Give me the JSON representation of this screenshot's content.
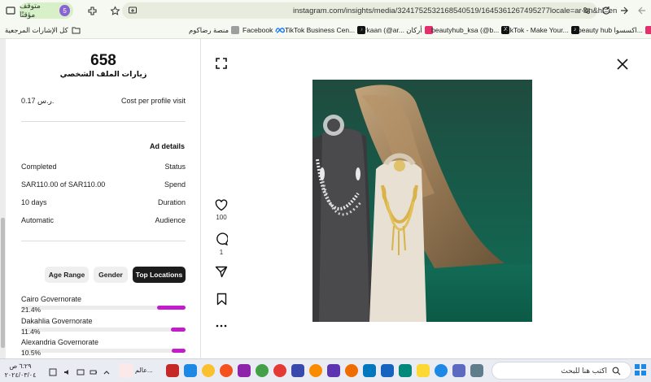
{
  "browser": {
    "url": "instagram.com/insights/media/3241752532168540519/1645361267495277locale=ar-en&hl=en",
    "profile_status": "متوقف مؤقتًا",
    "profile_initial": "5",
    "icons": [
      "back-icon",
      "forward-icon",
      "reload-icon",
      "site-settings-icon",
      "star-icon",
      "extensions-icon"
    ]
  },
  "bookmarks": {
    "all_bookmarks": "كل الإشارات المرجعية",
    "items": [
      {
        "label": "منصة رضاكوم",
        "color": "#9e9e9e"
      },
      {
        "label": "Facebook",
        "color": "#1877f2"
      },
      {
        "label": "TikTok Business Cen...",
        "color": "#111111"
      },
      {
        "label": "Arkaan (@ar... أركان",
        "color": "#111111"
      },
      {
        "label": "beautyhub_ksa (@b...",
        "color": "#e1306c"
      },
      {
        "label": "TikTok - Make Your...",
        "color": "#111111"
      },
      {
        "label": "beauty hub اكسسوا...",
        "color": "#e1306c"
      }
    ]
  },
  "insights": {
    "profile_visits_value": "658",
    "profile_visits_label": "زيارات الملف الشخصي",
    "cost_label": "Cost per profile visit",
    "cost_value": "0.17 ر.س.",
    "ad_details_title": "Ad details",
    "details": [
      {
        "label": "Status",
        "value": "Completed"
      },
      {
        "label": "Spend",
        "value": "SAR110.00 of SAR110.00"
      },
      {
        "label": "Duration",
        "value": "10 days"
      },
      {
        "label": "Audience",
        "value": "Automatic"
      }
    ],
    "tabs": [
      {
        "label": "Age Range",
        "active": false
      },
      {
        "label": "Gender",
        "active": false
      },
      {
        "label": "Top Locations",
        "active": true
      }
    ],
    "locations": [
      {
        "name": "Cairo Governorate",
        "percent": "21.4%",
        "share": 21.4
      },
      {
        "name": "Dakahlia Governorate",
        "percent": "11.4%",
        "share": 11.4
      },
      {
        "name": "Alexandria Governorate",
        "percent": "10.5%",
        "share": 10.5
      }
    ],
    "bar_color": "#c41ccc"
  },
  "post": {
    "likes": "100",
    "comments": "1",
    "icons": [
      "expand-icon",
      "close-icon",
      "heart-icon",
      "comment-icon",
      "share-icon",
      "save-icon",
      "more-icon"
    ]
  },
  "taskbar": {
    "search_placeholder": "اكتب هنا للبحث",
    "time": "٦:٢٩ ص",
    "date": "٢٠٢٤/٠٣/٠٤",
    "window_label": "عالم..."
  }
}
